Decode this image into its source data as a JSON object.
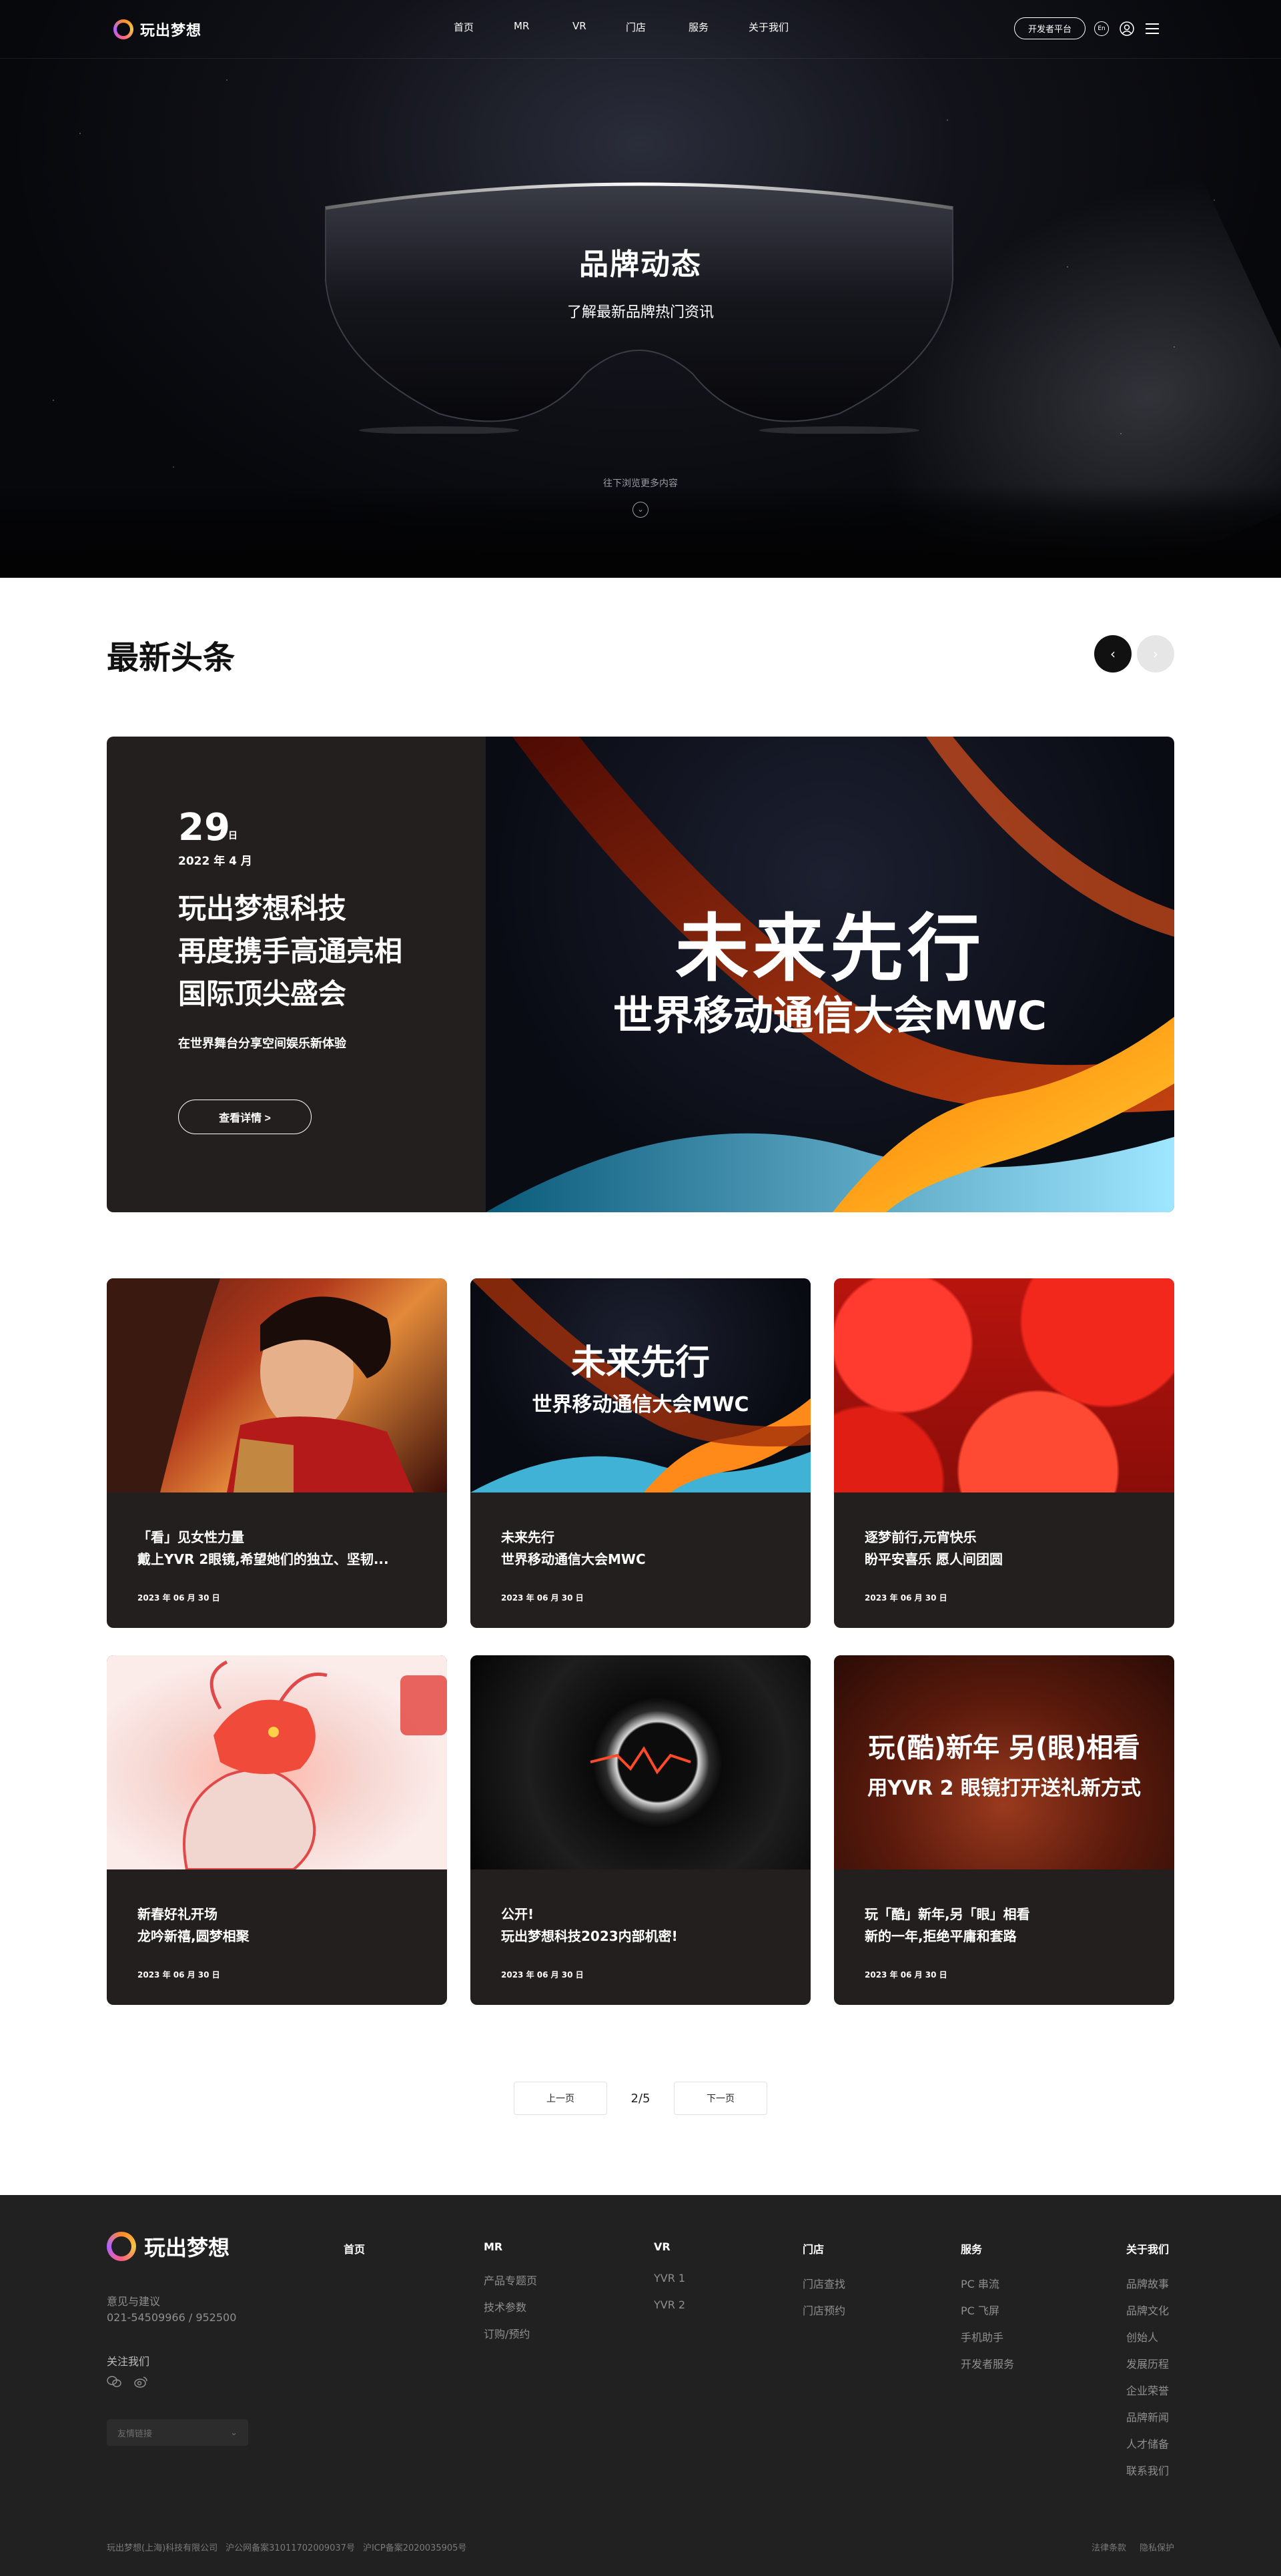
{
  "header": {
    "logo_text": "玩出梦想",
    "nav": [
      "首页",
      "MR",
      "VR",
      "门店",
      "服务",
      "关于我们"
    ],
    "dev_button": "开发者平台",
    "lang_icon": "En"
  },
  "hero": {
    "title": "品牌动态",
    "subtitle": "了解最新品牌热门资讯",
    "scroll_hint": "往下浏览更多内容"
  },
  "news": {
    "section_title": "最新头条",
    "feature": {
      "day": "29",
      "day_unit": "日",
      "month": "2022 年 4 月",
      "title_lines": [
        "玩出梦想科技",
        "再度携手高通亮相",
        "国际顶尖盛会"
      ],
      "desc": "在世界舞台分享空间娱乐新体验",
      "button": "查看详情 >",
      "image_title": "未来先行",
      "image_subtitle": "世界移动通信大会MWC"
    },
    "cards": [
      {
        "line1": "「看」见女性力量",
        "line2": "戴上YVR 2眼镜,希望她们的独立、坚韧...",
        "date": "2023 年 06 月 30 日",
        "overlay1": "",
        "overlay2": ""
      },
      {
        "line1": "未来先行",
        "line2": "世界移动通信大会MWC",
        "date": "2023 年 06 月 30 日",
        "overlay1": "未来先行",
        "overlay2": "世界移动通信大会MWC"
      },
      {
        "line1": "逐梦前行,元宵快乐",
        "line2": "盼平安喜乐 愿人间团圆",
        "date": "2023 年 06 月 30 日",
        "overlay1": "",
        "overlay2": ""
      },
      {
        "line1": "新春好礼开场",
        "line2": "龙吟新禧,圆梦相聚",
        "date": "2023 年 06 月 30 日",
        "overlay1": "",
        "overlay2": ""
      },
      {
        "line1": "公开!",
        "line2": "玩出梦想科技2023内部机密!",
        "date": "2023 年 06 月 30 日",
        "overlay1": "",
        "overlay2": ""
      },
      {
        "line1": "玩「酷」新年,另「眼」相看",
        "line2": "新的一年,拒绝平庸和套路",
        "date": "2023 年 06 月 30 日",
        "overlay1": "玩(酷)新年 另(眼)相看",
        "overlay2": "用YVR 2 眼镜打开送礼新方式"
      }
    ],
    "pager": {
      "prev": "上一页",
      "count": "2/5",
      "next": "下一页"
    }
  },
  "footer": {
    "logo_text": "玩出梦想",
    "feedback_label": "意见与建议",
    "phone": "021-54509966 / 952500",
    "follow_label": "关注我们",
    "links_select": "友情链接",
    "columns": [
      {
        "title": "首页",
        "items": []
      },
      {
        "title": "MR",
        "items": [
          "产品专题页",
          "技术参数",
          "订购/预约"
        ]
      },
      {
        "title": "VR",
        "items": [
          "YVR 1",
          "YVR 2"
        ]
      },
      {
        "title": "门店",
        "items": [
          "门店查找",
          "门店预约"
        ]
      },
      {
        "title": "服务",
        "items": [
          "PC 串流",
          "PC 飞屏",
          "手机助手",
          "开发者服务"
        ]
      },
      {
        "title": "关于我们",
        "items": [
          "品牌故事",
          "品牌文化",
          "创始人",
          "发展历程",
          "企业荣誉",
          "品牌新闻",
          "人才储备",
          "联系我们"
        ]
      }
    ],
    "company": "玩出梦想(上海)科技有限公司",
    "police_record": "沪公网备案31011702009037号",
    "icp_record": "沪ICP备案2020035905号",
    "legal": "法律条款",
    "privacy": "隐私保护"
  },
  "colors": {
    "dark_card": "#231f1e",
    "footer_bg": "#222121",
    "hero_bg": "#07080c"
  }
}
